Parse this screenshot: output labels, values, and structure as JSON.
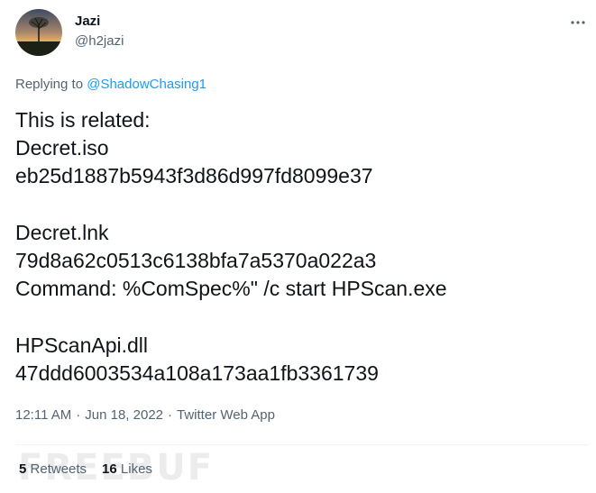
{
  "author": {
    "display_name": "Jazi",
    "handle": "@h2jazi",
    "avatar_icon": "sunset-landscape-avatar"
  },
  "reply": {
    "prefix": "Replying to ",
    "mention": "@ShadowChasing1"
  },
  "tweet": {
    "text": "This is related:\nDecret.iso\neb25d1887b5943f3d86d997fd8099e37\n\nDecret.lnk\n79d8a62c0513c6138bfa7a5370a022a3\nCommand: %ComSpec%\" /c start HPScan.exe\n\nHPScanApi.dll\n47ddd6003534a108a173aa1fb3361739"
  },
  "meta": {
    "time": "12:11 AM",
    "separator": "·",
    "date": "Jun 18, 2022",
    "source": "Twitter Web App"
  },
  "stats": {
    "retweets_count": "5",
    "retweets_label": "Retweets",
    "likes_count": "16",
    "likes_label": "Likes"
  },
  "watermark": "FREEBUF",
  "colors": {
    "text_primary": "#0f1419",
    "text_secondary": "#536471",
    "link": "#1d9bf0",
    "divider": "#eff3f4"
  }
}
